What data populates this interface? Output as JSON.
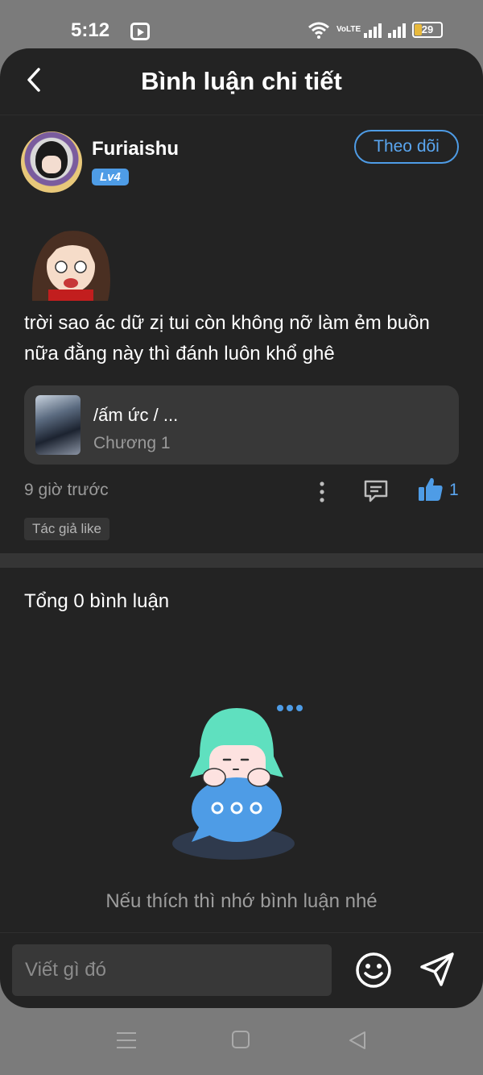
{
  "status_bar": {
    "time": "5:12",
    "network_label": "VoLTE",
    "battery": "29"
  },
  "header": {
    "title": "Bình luận chi tiết"
  },
  "post": {
    "username": "Furiaishu",
    "level": "Lv4",
    "follow_label": "Theo dõi",
    "comment": "trời sao ác dữ zị tui còn không nỡ làm ẻm buồn nữa đằng này thì đánh luôn khổ ghê",
    "chapter": {
      "title": "/ấm ức / ...",
      "subtitle": "Chương 1"
    },
    "time_ago": "9 giờ trước",
    "like_count": "1",
    "author_like_tag": "Tác giả like"
  },
  "replies": {
    "total_label": "Tổng 0 bình luận",
    "empty_message": "Nếu thích thì nhớ bình luận nhé"
  },
  "composer": {
    "placeholder": "Viết gì đó"
  },
  "colors": {
    "background": "#232323",
    "accent": "#4e9ce6",
    "card": "#383838"
  },
  "icons": [
    "back-icon",
    "more-icon",
    "comment-icon",
    "like-icon",
    "emoji-icon",
    "send-icon",
    "menu-icon",
    "home-icon",
    "nav-back-icon"
  ]
}
